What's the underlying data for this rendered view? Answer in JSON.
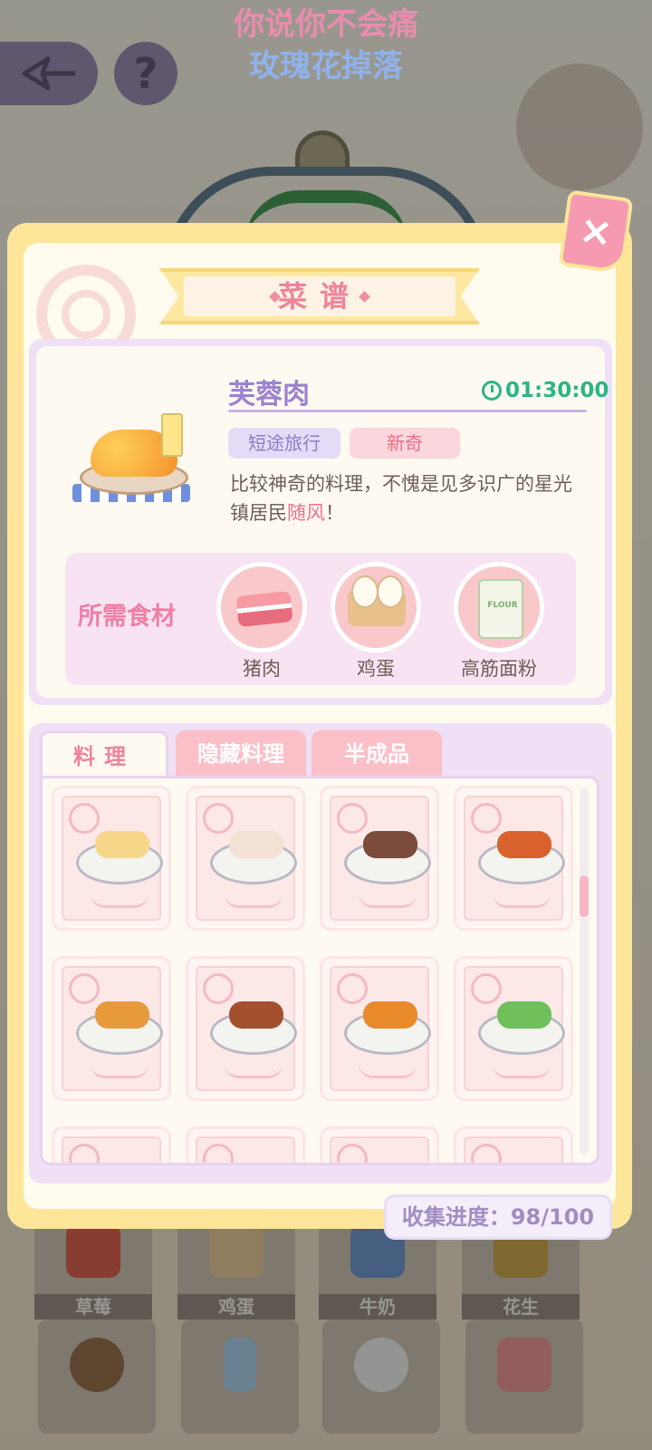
{
  "colors": {
    "accent_pink": "#ee839b",
    "accent_purple": "#9b83cf",
    "timer_green": "#2ab588",
    "panel_yellow": "#fde59a"
  },
  "background": {
    "lyrics": [
      "你说你不会痛",
      "玫瑰花掉落"
    ],
    "help_label": "?",
    "inventory": [
      {
        "label": "草莓"
      },
      {
        "label": "鸡蛋"
      },
      {
        "label": "牛奶"
      },
      {
        "label": "花生"
      },
      {
        "label": ""
      },
      {
        "label": ""
      },
      {
        "label": ""
      },
      {
        "label": ""
      }
    ]
  },
  "panel": {
    "title": "菜谱",
    "close_icon": "×",
    "recipe": {
      "name": "芙蓉肉",
      "time": "01:30:00",
      "tags": [
        "短途旅行",
        "新奇"
      ],
      "desc_prefix": "比较神奇的料理，不愧是见多识广的星光镇居民",
      "desc_highlight": "随风",
      "desc_suffix": "！",
      "ingredients_title": "所需食材",
      "ingredients": [
        {
          "name": "猪肉",
          "icon": "pork-icon"
        },
        {
          "name": "鸡蛋",
          "icon": "eggs-icon"
        },
        {
          "name": "高筋面粉",
          "icon": "flour-bag-icon"
        }
      ],
      "flour_bag_text": "FLOUR"
    },
    "tabs": [
      {
        "label": "料理",
        "active": true
      },
      {
        "label": "隐藏料理",
        "active": false
      },
      {
        "label": "半成品",
        "active": false
      }
    ],
    "dishes": [
      {
        "icon": "toast-icon",
        "color": "#f6d78a"
      },
      {
        "icon": "steamed-bun-icon",
        "color": "#f3e1d3"
      },
      {
        "icon": "kebab-icon",
        "color": "#7a4a3a"
      },
      {
        "icon": "glazed-tofu-icon",
        "color": "#d9622c"
      },
      {
        "icon": "fried-fish-icon",
        "color": "#e79a3c"
      },
      {
        "icon": "meat-platter-icon",
        "color": "#a4502e"
      },
      {
        "icon": "fried-chicken-icon",
        "color": "#e88a2a"
      },
      {
        "icon": "veggie-skewer-icon",
        "color": "#6fbf5a"
      },
      {
        "icon": "",
        "color": "#fde8e8"
      },
      {
        "icon": "",
        "color": "#fde8e8"
      },
      {
        "icon": "",
        "color": "#fde8e8"
      },
      {
        "icon": "",
        "color": "#fde8e8"
      }
    ],
    "progress_label": "收集进度：",
    "progress_value": "98/100"
  }
}
